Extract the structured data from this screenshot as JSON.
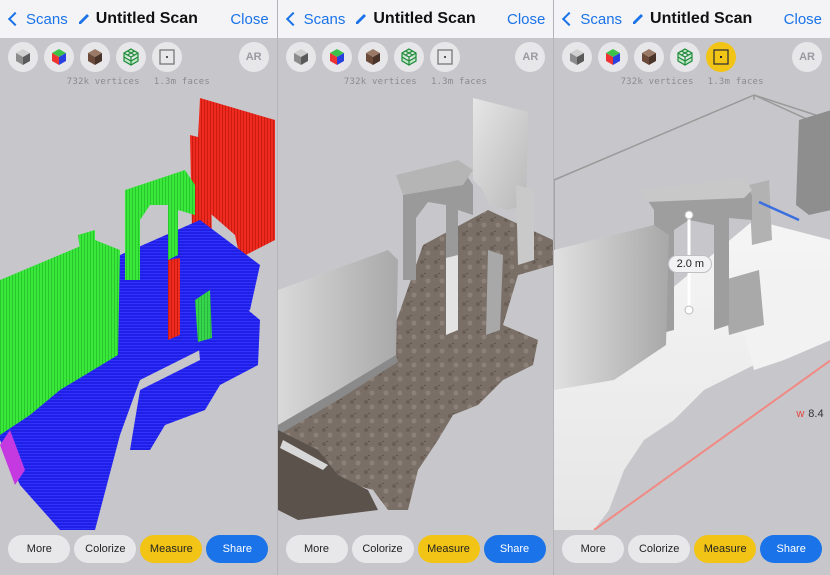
{
  "nav": {
    "back_label": "Scans",
    "title": "Untitled Scan",
    "close_label": "Close"
  },
  "toolbar": {
    "ar_label": "AR",
    "vertices": "732k vertices",
    "faces": "1.3m faces",
    "tools": [
      {
        "icon": "grey-cube-icon"
      },
      {
        "icon": "rgb-cube-icon"
      },
      {
        "icon": "textured-cube-icon"
      },
      {
        "icon": "wireframe-cube-icon"
      },
      {
        "icon": "bounding-box-icon"
      }
    ]
  },
  "bottom_buttons": {
    "more": "More",
    "colorize": "Colorize",
    "measure": "Measure",
    "share": "Share"
  },
  "measurement": {
    "height_label": "2.0 m",
    "width_prefix": "w",
    "width_value": "8.4"
  },
  "panels": [
    {
      "mode": "normals",
      "active_tool": "none"
    },
    {
      "mode": "textured",
      "active_tool": "none"
    },
    {
      "mode": "measure",
      "active_tool": "bounding-box"
    }
  ],
  "colors": {
    "accent_blue": "#1a73e8",
    "measure_yellow": "#f2c416",
    "panel_bg": "#c7c7cb"
  }
}
